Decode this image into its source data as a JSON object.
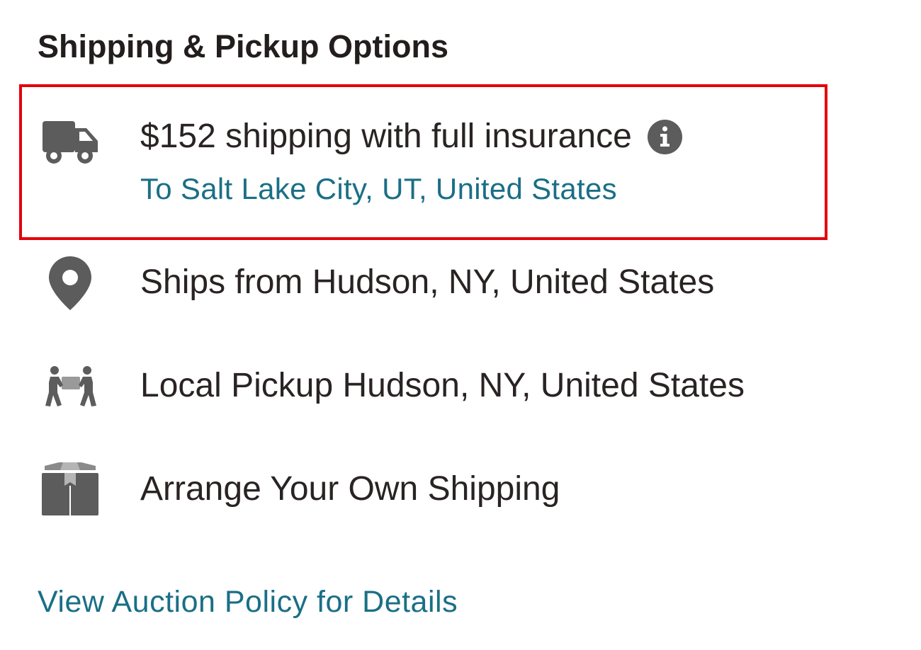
{
  "section": {
    "title": "Shipping & Pickup Options"
  },
  "shipping": {
    "price_text": "$152 shipping with full insurance",
    "destination_link": "To Salt Lake City, UT, United States",
    "icon": "truck-icon",
    "info_icon": "info-icon"
  },
  "ships_from": {
    "text": "Ships from Hudson, NY, United States",
    "icon": "map-pin-icon"
  },
  "local_pickup": {
    "text": "Local Pickup Hudson, NY, United States",
    "icon": "people-carry-icon"
  },
  "own_shipping": {
    "text": "Arrange Your Own Shipping",
    "icon": "box-icon"
  },
  "policy": {
    "link_text": "View Auction Policy for Details"
  },
  "colors": {
    "link": "#1a6f86",
    "text": "#2a2323",
    "icon": "#5c5c5c",
    "highlight_border": "#e3000b"
  }
}
